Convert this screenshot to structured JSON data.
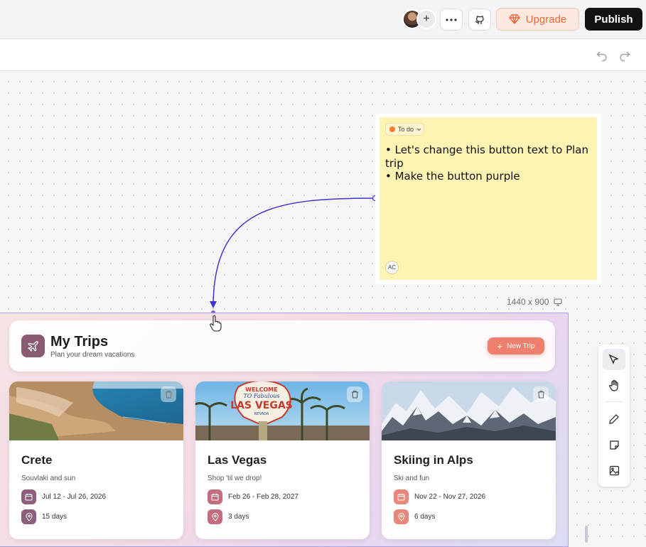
{
  "topbar": {
    "upgrade_label": "Upgrade",
    "publish_label": "Publish",
    "more_icon": "more-icon",
    "github_icon": "github-icon",
    "add_collaborator_icon": "plus-icon"
  },
  "sticky_note": {
    "status_label": "To do",
    "status_color": "#f27a30",
    "lines": [
      "• Let's change this button text to Plan trip",
      "• Make the button purple"
    ],
    "author_initials": "AC"
  },
  "frame": {
    "size_label": "1440 x 900"
  },
  "app": {
    "title": "My Trips",
    "subtitle": "Plan your dream vacations",
    "new_trip_label": "New Trip",
    "new_trip_color": "#ef7f6c",
    "trips": [
      {
        "name": "Crete",
        "description": "Souvlaki and sun",
        "dates": "Jul 12 - Jul 26, 2026",
        "duration": "15 days",
        "accent": "#8d5f7b"
      },
      {
        "name": "Las Vegas",
        "description": "Shop 'til we drop!",
        "dates": "Feb 26 - Feb 28, 2027",
        "duration": "3 days",
        "accent": "#c46d7e"
      },
      {
        "name": "Skiing in Alps",
        "description": "Ski and fun",
        "dates": "Nov 22 - Nov 27, 2026",
        "duration": "6 days",
        "accent": "#e8877a"
      }
    ],
    "vegas_sign": {
      "line1": "WELCOME",
      "line2": "TO Fabulous",
      "line3": "LAS VEGAS",
      "line4": "NEVADA"
    }
  },
  "tools": [
    "pointer-icon",
    "hand-icon",
    "pencil-icon",
    "sticky-note-icon",
    "image-icon"
  ]
}
